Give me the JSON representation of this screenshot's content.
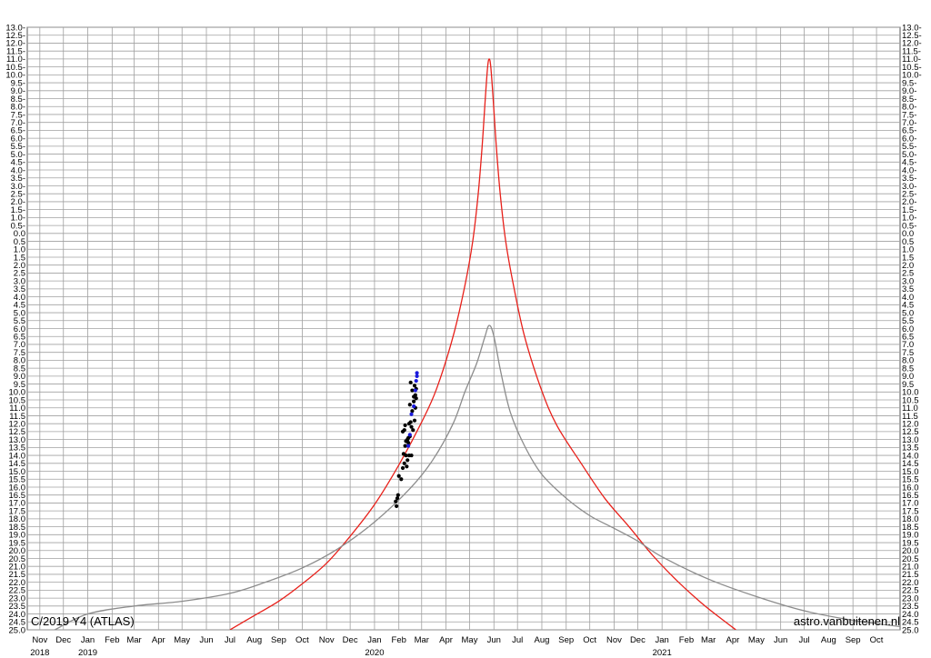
{
  "chart_data": {
    "type": "line",
    "title": "C/2019 Y4 (ATLAS)",
    "credit": "astro.vanbuitenen.nl",
    "xlabel": "",
    "ylabel": "",
    "x_range": [
      "2018-10-16",
      "2021-10-31"
    ],
    "ylim": [
      25.0,
      -13.0
    ],
    "y_inverted": true,
    "grid": true,
    "months": [
      {
        "label": "Nov",
        "date": "2018-11-01"
      },
      {
        "label": "Dec",
        "date": "2018-12-01"
      },
      {
        "label": "Jan",
        "date": "2019-01-01"
      },
      {
        "label": "Feb",
        "date": "2019-02-01"
      },
      {
        "label": "Mar",
        "date": "2019-03-01"
      },
      {
        "label": "Apr",
        "date": "2019-04-01"
      },
      {
        "label": "May",
        "date": "2019-05-01"
      },
      {
        "label": "Jun",
        "date": "2019-06-01"
      },
      {
        "label": "Jul",
        "date": "2019-07-01"
      },
      {
        "label": "Aug",
        "date": "2019-08-01"
      },
      {
        "label": "Sep",
        "date": "2019-09-01"
      },
      {
        "label": "Oct",
        "date": "2019-10-01"
      },
      {
        "label": "Nov",
        "date": "2019-11-01"
      },
      {
        "label": "Dec",
        "date": "2019-12-01"
      },
      {
        "label": "Jan",
        "date": "2020-01-01"
      },
      {
        "label": "Feb",
        "date": "2020-02-01"
      },
      {
        "label": "Mar",
        "date": "2020-03-01"
      },
      {
        "label": "Apr",
        "date": "2020-04-01"
      },
      {
        "label": "May",
        "date": "2020-05-01"
      },
      {
        "label": "Jun",
        "date": "2020-06-01"
      },
      {
        "label": "Jul",
        "date": "2020-07-01"
      },
      {
        "label": "Aug",
        "date": "2020-08-01"
      },
      {
        "label": "Sep",
        "date": "2020-09-01"
      },
      {
        "label": "Oct",
        "date": "2020-10-01"
      },
      {
        "label": "Nov",
        "date": "2020-11-01"
      },
      {
        "label": "Dec",
        "date": "2020-12-01"
      },
      {
        "label": "Jan",
        "date": "2021-01-01"
      },
      {
        "label": "Feb",
        "date": "2021-02-01"
      },
      {
        "label": "Mar",
        "date": "2021-03-01"
      },
      {
        "label": "Apr",
        "date": "2021-04-01"
      },
      {
        "label": "May",
        "date": "2021-05-01"
      },
      {
        "label": "Jun",
        "date": "2021-06-01"
      },
      {
        "label": "Jul",
        "date": "2021-07-01"
      },
      {
        "label": "Aug",
        "date": "2021-08-01"
      },
      {
        "label": "Sep",
        "date": "2021-09-01"
      },
      {
        "label": "Oct",
        "date": "2021-10-01"
      }
    ],
    "years": [
      {
        "label": "2018",
        "date": "2018-11-01"
      },
      {
        "label": "2019",
        "date": "2019-01-01"
      },
      {
        "label": "2020",
        "date": "2020-01-01"
      },
      {
        "label": "2021",
        "date": "2021-01-01"
      }
    ],
    "y_ticks": [
      {
        "value": -13.0,
        "label": "13.0-"
      },
      {
        "value": -12.5,
        "label": "12.5-"
      },
      {
        "value": -12.0,
        "label": "12.0-"
      },
      {
        "value": -11.5,
        "label": "11.5-"
      },
      {
        "value": -11.0,
        "label": "11.0-"
      },
      {
        "value": -10.5,
        "label": "10.5-"
      },
      {
        "value": -10.0,
        "label": "10.0-"
      },
      {
        "value": -9.5,
        "label": "9.5-"
      },
      {
        "value": -9.0,
        "label": "9.0-"
      },
      {
        "value": -8.5,
        "label": "8.5-"
      },
      {
        "value": -8.0,
        "label": "8.0-"
      },
      {
        "value": -7.5,
        "label": "7.5-"
      },
      {
        "value": -7.0,
        "label": "7.0-"
      },
      {
        "value": -6.5,
        "label": "6.5-"
      },
      {
        "value": -6.0,
        "label": "6.0-"
      },
      {
        "value": -5.5,
        "label": "5.5-"
      },
      {
        "value": -5.0,
        "label": "5.0-"
      },
      {
        "value": -4.5,
        "label": "4.5-"
      },
      {
        "value": -4.0,
        "label": "4.0-"
      },
      {
        "value": -3.5,
        "label": "3.5-"
      },
      {
        "value": -3.0,
        "label": "3.0-"
      },
      {
        "value": -2.5,
        "label": "2.5-"
      },
      {
        "value": -2.0,
        "label": "2.0-"
      },
      {
        "value": -1.5,
        "label": "1.5-"
      },
      {
        "value": -1.0,
        "label": "1.0-"
      },
      {
        "value": -0.5,
        "label": "0.5-"
      },
      {
        "value": 0.0,
        "label": "0.0"
      },
      {
        "value": 0.5,
        "label": "0.5"
      },
      {
        "value": 1.0,
        "label": "1.0"
      },
      {
        "value": 1.5,
        "label": "1.5"
      },
      {
        "value": 2.0,
        "label": "2.0"
      },
      {
        "value": 2.5,
        "label": "2.5"
      },
      {
        "value": 3.0,
        "label": "3.0"
      },
      {
        "value": 3.5,
        "label": "3.5"
      },
      {
        "value": 4.0,
        "label": "4.0"
      },
      {
        "value": 4.5,
        "label": "4.5"
      },
      {
        "value": 5.0,
        "label": "5.0"
      },
      {
        "value": 5.5,
        "label": "5.5"
      },
      {
        "value": 6.0,
        "label": "6.0"
      },
      {
        "value": 6.5,
        "label": "6.5"
      },
      {
        "value": 7.0,
        "label": "7.0"
      },
      {
        "value": 7.5,
        "label": "7.5"
      },
      {
        "value": 8.0,
        "label": "8.0"
      },
      {
        "value": 8.5,
        "label": "8.5"
      },
      {
        "value": 9.0,
        "label": "9.0"
      },
      {
        "value": 9.5,
        "label": "9.5"
      },
      {
        "value": 10.0,
        "label": "10.0"
      },
      {
        "value": 10.5,
        "label": "10.5"
      },
      {
        "value": 11.0,
        "label": "11.0"
      },
      {
        "value": 11.5,
        "label": "11.5"
      },
      {
        "value": 12.0,
        "label": "12.0"
      },
      {
        "value": 12.5,
        "label": "12.5"
      },
      {
        "value": 13.0,
        "label": "13.0"
      },
      {
        "value": 13.5,
        "label": "13.5"
      },
      {
        "value": 14.0,
        "label": "14.0"
      },
      {
        "value": 14.5,
        "label": "14.5"
      },
      {
        "value": 15.0,
        "label": "15.0"
      },
      {
        "value": 15.5,
        "label": "15.5"
      },
      {
        "value": 16.0,
        "label": "16.0"
      },
      {
        "value": 16.5,
        "label": "16.5"
      },
      {
        "value": 17.0,
        "label": "17.0"
      },
      {
        "value": 17.5,
        "label": "17.5"
      },
      {
        "value": 18.0,
        "label": "18.0"
      },
      {
        "value": 18.5,
        "label": "18.5"
      },
      {
        "value": 19.0,
        "label": "19.0"
      },
      {
        "value": 19.5,
        "label": "19.5"
      },
      {
        "value": 20.0,
        "label": "20.0"
      },
      {
        "value": 20.5,
        "label": "20.5"
      },
      {
        "value": 21.0,
        "label": "21.0"
      },
      {
        "value": 21.5,
        "label": "21.5"
      },
      {
        "value": 22.0,
        "label": "22.0"
      },
      {
        "value": 22.5,
        "label": "22.5"
      },
      {
        "value": 23.0,
        "label": "23.0"
      },
      {
        "value": 23.5,
        "label": "23.5"
      },
      {
        "value": 24.0,
        "label": "24.0"
      },
      {
        "value": 24.5,
        "label": "24.5"
      },
      {
        "value": 25.0,
        "label": "25.0"
      }
    ],
    "series": [
      {
        "kind": "line",
        "color": "#e8201a",
        "points": [
          [
            "2019-07-01",
            25.0
          ],
          [
            "2019-08-01",
            24.1
          ],
          [
            "2019-09-01",
            23.2
          ],
          [
            "2019-10-01",
            22.1
          ],
          [
            "2019-11-01",
            20.8
          ],
          [
            "2019-12-01",
            19.1
          ],
          [
            "2020-01-01",
            17.1
          ],
          [
            "2020-02-01",
            14.6
          ],
          [
            "2020-03-01",
            11.9
          ],
          [
            "2020-03-20",
            9.8
          ],
          [
            "2020-04-10",
            6.5
          ],
          [
            "2020-04-25",
            3.3
          ],
          [
            "2020-05-05",
            0.5
          ],
          [
            "2020-05-12",
            -2.5
          ],
          [
            "2020-05-17",
            -5.5
          ],
          [
            "2020-05-21",
            -8.5
          ],
          [
            "2020-05-24",
            -10.5
          ],
          [
            "2020-05-26",
            -11.0
          ],
          [
            "2020-05-28",
            -10.5
          ],
          [
            "2020-05-31",
            -8.5
          ],
          [
            "2020-06-04",
            -5.5
          ],
          [
            "2020-06-09",
            -2.5
          ],
          [
            "2020-06-16",
            0.5
          ],
          [
            "2020-06-26",
            3.3
          ],
          [
            "2020-07-10",
            6.5
          ],
          [
            "2020-07-31",
            9.8
          ],
          [
            "2020-08-20",
            12.1
          ],
          [
            "2020-09-20",
            14.5
          ],
          [
            "2020-10-20",
            16.7
          ],
          [
            "2020-11-20",
            18.5
          ],
          [
            "2020-12-20",
            20.3
          ],
          [
            "2021-01-20",
            21.9
          ],
          [
            "2021-02-20",
            23.3
          ],
          [
            "2021-03-20",
            24.4
          ],
          [
            "2021-04-05",
            25.0
          ]
        ]
      },
      {
        "kind": "line",
        "color": "#8c8c8c",
        "points": [
          [
            "2018-11-20",
            25.0
          ],
          [
            "2019-01-01",
            24.0
          ],
          [
            "2019-03-01",
            23.5
          ],
          [
            "2019-05-01",
            23.2
          ],
          [
            "2019-07-01",
            22.7
          ],
          [
            "2019-08-15",
            22.0
          ],
          [
            "2019-10-01",
            21.1
          ],
          [
            "2019-11-15",
            19.9
          ],
          [
            "2020-01-01",
            18.2
          ],
          [
            "2020-02-15",
            16.1
          ],
          [
            "2020-03-15",
            14.3
          ],
          [
            "2020-04-10",
            12.0
          ],
          [
            "2020-04-25",
            10.0
          ],
          [
            "2020-05-10",
            8.2
          ],
          [
            "2020-05-20",
            6.6
          ],
          [
            "2020-05-26",
            5.8
          ],
          [
            "2020-06-01",
            6.5
          ],
          [
            "2020-06-10",
            8.8
          ],
          [
            "2020-06-22",
            11.3
          ],
          [
            "2020-07-10",
            13.4
          ],
          [
            "2020-08-01",
            15.2
          ],
          [
            "2020-09-01",
            16.7
          ],
          [
            "2020-10-01",
            17.8
          ],
          [
            "2020-11-01",
            18.6
          ],
          [
            "2020-12-01",
            19.4
          ],
          [
            "2021-01-01",
            20.4
          ],
          [
            "2021-03-01",
            21.8
          ],
          [
            "2021-05-01",
            22.9
          ],
          [
            "2021-07-01",
            23.8
          ],
          [
            "2021-09-01",
            24.4
          ],
          [
            "2021-10-31",
            24.8
          ]
        ]
      },
      {
        "kind": "scatter",
        "color": "#000000",
        "points": [
          [
            "2020-01-28",
            16.9
          ],
          [
            "2020-01-29",
            17.2
          ],
          [
            "2020-01-30",
            16.7
          ],
          [
            "2020-01-31",
            16.5
          ],
          [
            "2020-02-01",
            15.3
          ],
          [
            "2020-02-04",
            15.5
          ],
          [
            "2020-02-06",
            14.8
          ],
          [
            "2020-02-07",
            13.9
          ],
          [
            "2020-02-08",
            14.5
          ],
          [
            "2020-02-08",
            12.4
          ],
          [
            "2020-02-09",
            12.1
          ],
          [
            "2020-02-10",
            13.1
          ],
          [
            "2020-02-10",
            14.0
          ],
          [
            "2020-02-11",
            14.7
          ],
          [
            "2020-02-12",
            13.0
          ],
          [
            "2020-02-12",
            14.3
          ],
          [
            "2020-02-13",
            13.2
          ],
          [
            "2020-02-14",
            12.0
          ],
          [
            "2020-02-14",
            14.0
          ],
          [
            "2020-02-15",
            10.8
          ],
          [
            "2020-02-15",
            12.8
          ],
          [
            "2020-02-16",
            11.9
          ],
          [
            "2020-02-16",
            9.4
          ],
          [
            "2020-02-17",
            12.2
          ],
          [
            "2020-02-17",
            14.0
          ],
          [
            "2020-02-18",
            11.2
          ],
          [
            "2020-02-18",
            9.9
          ],
          [
            "2020-02-19",
            12.4
          ],
          [
            "2020-02-20",
            10.3
          ],
          [
            "2020-02-20",
            10.6
          ],
          [
            "2020-02-21",
            11.8
          ],
          [
            "2020-02-21",
            9.6
          ],
          [
            "2020-02-22",
            10.2
          ],
          [
            "2020-02-22",
            11.0
          ],
          [
            "2020-02-23",
            9.8
          ],
          [
            "2020-02-23",
            10.4
          ],
          [
            "2020-02-06",
            12.5
          ],
          [
            "2020-02-13",
            12.9
          ],
          [
            "2020-02-09",
            13.4
          ]
        ]
      },
      {
        "kind": "scatter",
        "color": "#1a1adc",
        "points": [
          [
            "2020-02-13",
            13.4
          ],
          [
            "2020-02-15",
            12.7
          ],
          [
            "2020-02-17",
            11.4
          ],
          [
            "2020-02-22",
            9.9
          ],
          [
            "2020-02-23",
            9.3
          ],
          [
            "2020-02-24",
            9.0
          ],
          [
            "2020-02-24",
            8.8
          ],
          [
            "2020-02-20",
            10.9
          ]
        ]
      }
    ]
  }
}
